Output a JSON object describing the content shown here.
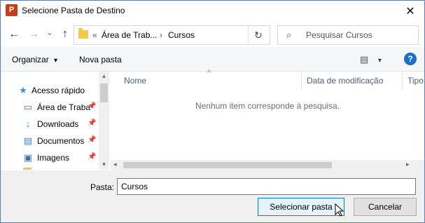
{
  "window": {
    "title": "Selecione Pasta de Destino",
    "app_icon": "P",
    "close": "✕"
  },
  "address": {
    "back": "←",
    "forward": "→",
    "dropdown": "⌄",
    "up": "↑",
    "overflow": "«",
    "crumbs": [
      "Área de Trab...",
      "Cursos"
    ],
    "crumb_sep": "›",
    "refresh": "↻",
    "search_placeholder": "Pesquisar Cursos",
    "search_icon": "⌕"
  },
  "toolbar": {
    "organize": "Organizar",
    "organize_caret": "▾",
    "new_folder": "Nova pasta",
    "view_icon": "▤",
    "view_caret": "▾",
    "help": "?"
  },
  "nav": {
    "items": [
      {
        "label": "Acesso rápido",
        "icon": "star-icon",
        "glyph": "★",
        "color": "#3d8fd8"
      },
      {
        "label": "Área de Traba",
        "icon": "desktop-icon",
        "glyph": "▭",
        "color": "#1e88e5"
      },
      {
        "label": "Downloads",
        "icon": "download-icon",
        "glyph": "↓",
        "color": "#1e88e5"
      },
      {
        "label": "Documentos",
        "icon": "document-icon",
        "glyph": "▤",
        "color": "#5a7fb5"
      },
      {
        "label": "Imagens",
        "icon": "image-icon",
        "glyph": "▣",
        "color": "#3a6ea5"
      }
    ],
    "pin": "📌"
  },
  "list": {
    "columns": [
      "Nome",
      "Data de modificação",
      "Tipo"
    ],
    "sort_indicator": "^",
    "empty_message": "Nenhum item corresponde à pesquisa."
  },
  "footer": {
    "folder_label": "Pasta:",
    "folder_value": "Cursos",
    "select_button": "Selecionar pasta",
    "cancel_button": "Cancelar"
  }
}
